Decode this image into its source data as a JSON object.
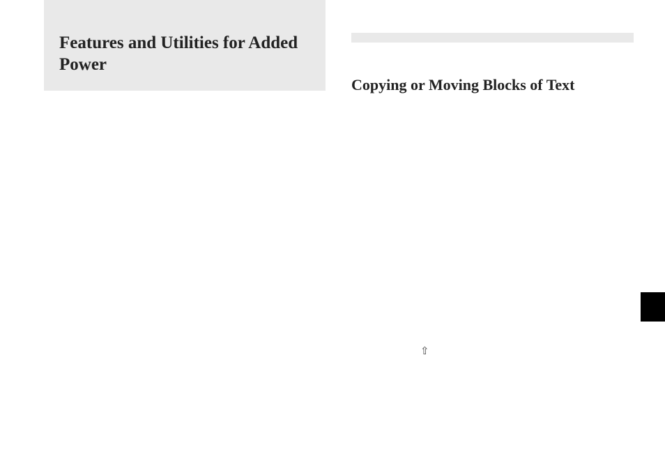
{
  "left": {
    "heading": "Features and Utilities for Added Power"
  },
  "right": {
    "heading": "Copying or Moving Blocks of Text"
  },
  "arrow": "⇧"
}
